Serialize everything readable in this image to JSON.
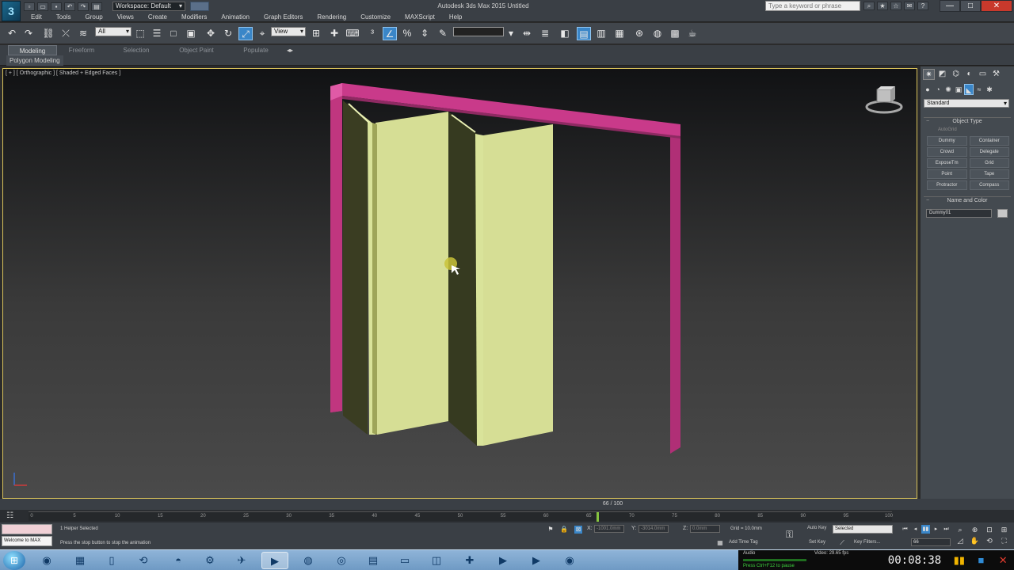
{
  "app": {
    "logo": "3",
    "window_title": "Autodesk 3ds Max  2015    Untitled",
    "workspace": "Workspace: Default",
    "search_placeholder": "Type a keyword or phrase"
  },
  "window_controls": {
    "minimize": "—",
    "maximize": "□",
    "close": "✕"
  },
  "menu": [
    "Edit",
    "Tools",
    "Group",
    "Views",
    "Create",
    "Modifiers",
    "Animation",
    "Graph Editors",
    "Rendering",
    "Customize",
    "MAXScript",
    "Help"
  ],
  "toolbar": {
    "selection_filter": "All",
    "reference_coord": "View",
    "named_selection": ""
  },
  "ribbon": {
    "tabs": [
      "Modeling",
      "Freeform",
      "Selection",
      "Object Paint",
      "Populate"
    ],
    "active_tab": "Modeling",
    "panel_label": "Polygon Modeling"
  },
  "viewport": {
    "label": "[ + ] [ Orthographic ] [ Shaded + Edged Faces ]"
  },
  "command_panel": {
    "category": "Standard",
    "object_type_header": "Object Type",
    "autogrid": "AutoGrid",
    "object_buttons": [
      "Dummy",
      "Container",
      "Crowd",
      "Delegate",
      "ExposeTm",
      "Grid",
      "Point",
      "Tape",
      "Protractor",
      "Compass"
    ],
    "name_color_header": "Name and Color",
    "object_name": "Dummy01"
  },
  "timeline": {
    "frame_display": "66 / 100",
    "current_frame": 66,
    "total_frames": 100,
    "ticks": [
      "0",
      "5",
      "10",
      "15",
      "20",
      "25",
      "30",
      "35",
      "40",
      "45",
      "50",
      "55",
      "60",
      "65",
      "70",
      "75",
      "80",
      "85",
      "90",
      "95",
      "100"
    ]
  },
  "status": {
    "selection": "1 Helper Selected",
    "prompt": "Press the stop button to stop the animation",
    "welcome": "Welcome to MAX",
    "x_label": "X:",
    "y_label": "Y:",
    "z_label": "Z:",
    "x_value": "-1001.0mm",
    "y_value": "-3014.0mm",
    "z_value": "0.0mm",
    "grid": "Grid = 10.0mm",
    "add_time_tag": "Add Time Tag",
    "auto_key": "Auto Key",
    "set_key": "Set Key",
    "key_mode": "Selected",
    "key_filters": "Key Filters...",
    "frame_field": "66"
  },
  "recorder": {
    "audio": "Audio",
    "video": "Video: 29.65 fps",
    "info": "Press Ctrl+F12 to pause",
    "timer": "00:08:38"
  }
}
